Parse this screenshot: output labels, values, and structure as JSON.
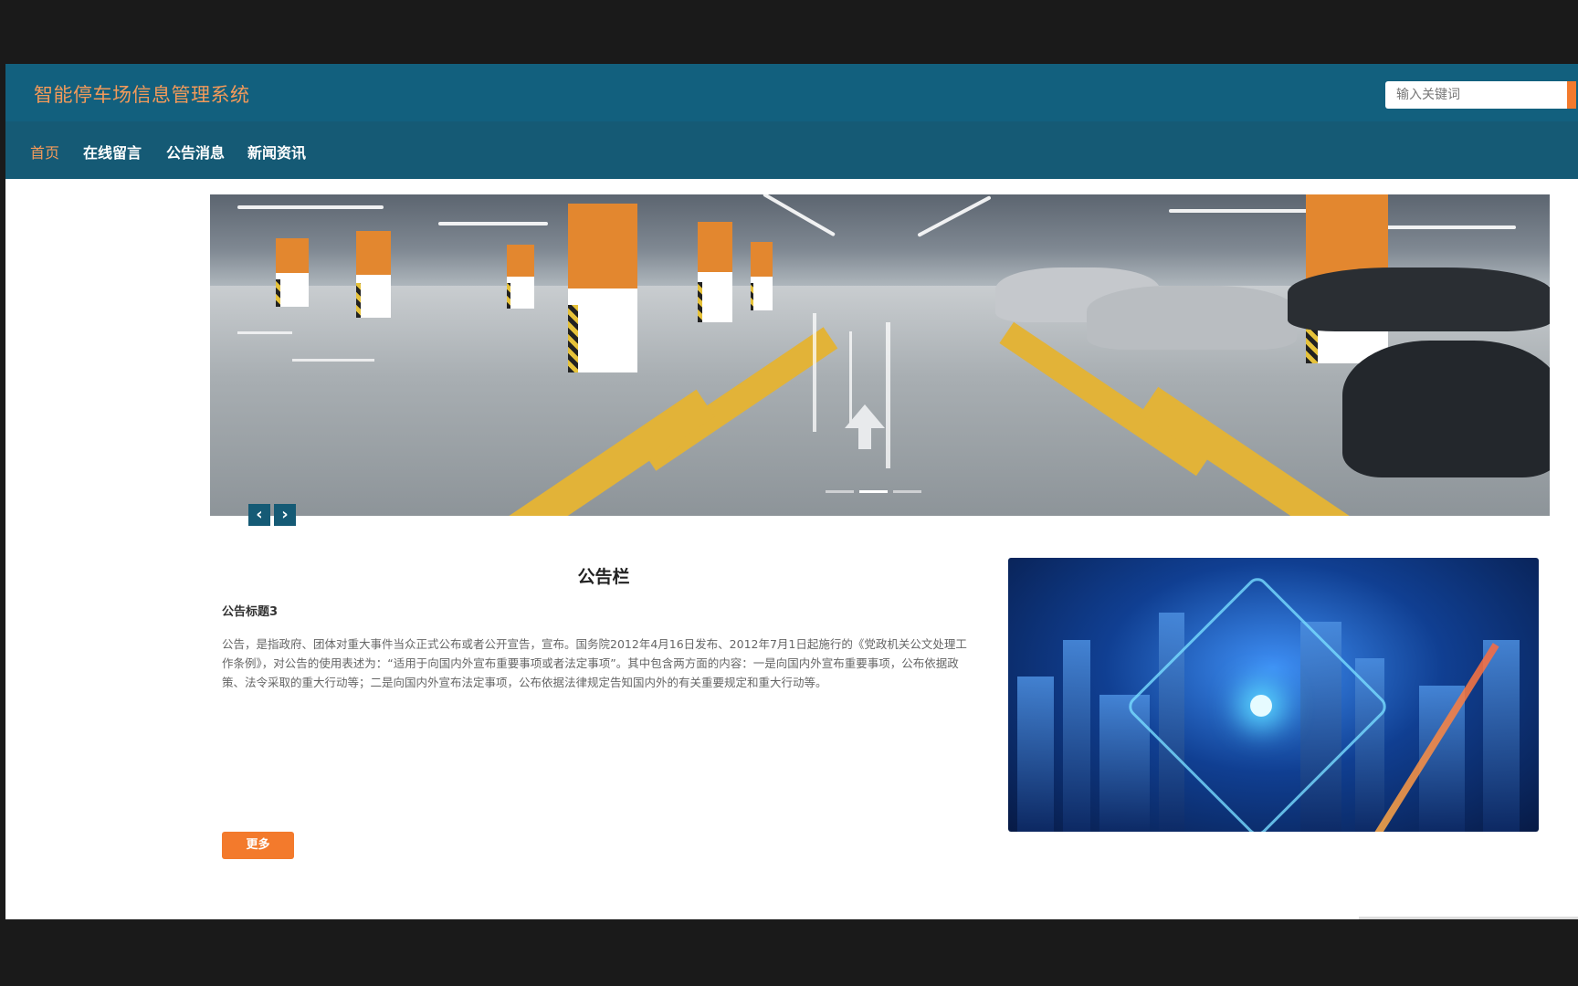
{
  "header": {
    "site_title": "智能停车场信息管理系统"
  },
  "nav": {
    "items": [
      {
        "label": "首页",
        "active": true
      },
      {
        "label": "在线留言",
        "active": false
      },
      {
        "label": "公告消息",
        "active": false
      },
      {
        "label": "新闻资讯",
        "active": false
      }
    ]
  },
  "search": {
    "placeholder": "输入关键词"
  },
  "carousel": {
    "slide_count": 3,
    "active_index": 1,
    "prev_label": "‹",
    "next_label": "›"
  },
  "notice": {
    "heading": "公告栏",
    "item_title": "公告标题3",
    "body": "公告，是指政府、团体对重大事件当众正式公布或者公开宣告，宣布。国务院2012年4月16日发布、2012年7月1日起施行的《党政机关公文处理工作条例》，对公告的使用表述为：“适用于向国内外宣布重要事项或者法定事项”。其中包含两方面的内容：一是向国内外宣布重要事项，公布依据政策、法令采取的重大行动等；二是向国内外宣布法定事项，公布依据法律规定告知国内外的有关重要规定和重大行动等。",
    "more_label": "更多"
  },
  "colors": {
    "header_bg": "#12607e",
    "nav_bg": "#155a75",
    "accent": "#f37a2c",
    "title_text": "#f39a5a"
  }
}
